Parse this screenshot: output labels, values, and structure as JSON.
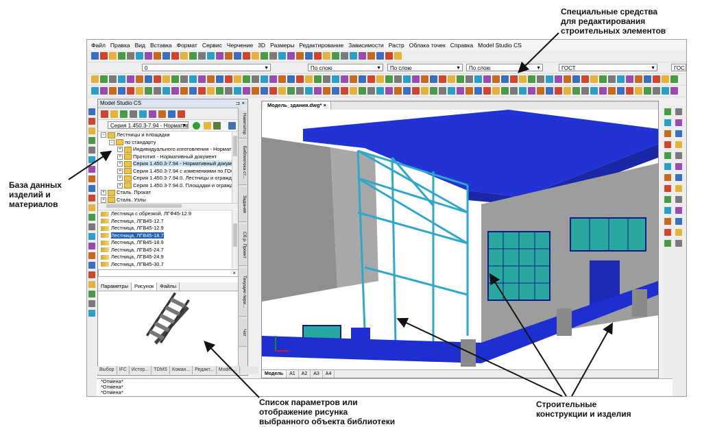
{
  "annotations": {
    "top_right": "Специальные средства\nдля редактирования\nстроительных элементов",
    "left": "База данных\nизделий и\nматериалов",
    "bottom_center": "Список параметров или\nотображение рисунка\nвыбранного объекта библиотеки",
    "bottom_right": "Строительные\nконструкции и изделия"
  },
  "menu": [
    "Файл",
    "Правка",
    "Вид",
    "Вставка",
    "Формат",
    "Сервис",
    "Черчение",
    "3D",
    "Размеры",
    "Редактирование",
    "Зависимости",
    "Растр",
    "Облака точек",
    "Справка",
    "Model Studio CS"
  ],
  "toolbar": {
    "layer_value": "0",
    "linetype_combo": "По слою",
    "lineweight_combo": "По слою",
    "color_combo": "По слою",
    "textstyle_combo": "ГОСТ",
    "dimstyle_combo": "ГОС"
  },
  "panel": {
    "title": "Model Studio CS",
    "pin": "⊐ ×",
    "series_combo": "Серия 1.450.3-7.94 - Норматив",
    "tree": [
      {
        "label": "Лестницы и площадки",
        "level": 0,
        "exp": "−",
        "sel": false
      },
      {
        "label": "по стандарту",
        "level": 1,
        "exp": "−",
        "sel": false
      },
      {
        "label": "Индивидуального изготовления - Норматив",
        "level": 2,
        "exp": "+",
        "sel": false
      },
      {
        "label": "Прототип - Нормативный документ",
        "level": 2,
        "exp": "+",
        "sel": false
      },
      {
        "label": "Серия 1.450.3-7.94 - Нормативный документ",
        "level": 2,
        "exp": "+",
        "sel": true
      },
      {
        "label": "Серия 1.450.3-7.94 с изменениями по ГОСТ",
        "level": 2,
        "exp": "+",
        "sel": false
      },
      {
        "label": "Серия 1.450.3-7.94.0. Лестницы и ограждения",
        "level": 2,
        "exp": "+",
        "sel": false
      },
      {
        "label": "Серия 1.450.3-7.94.0. Площадки и ограждения",
        "level": 2,
        "exp": "+",
        "sel": false
      },
      {
        "label": "Сталь. Прокат",
        "level": 0,
        "exp": "+",
        "sel": false
      },
      {
        "label": "Сталь. Узлы",
        "level": 0,
        "exp": "+",
        "sel": false
      }
    ],
    "list": [
      {
        "label": "Лестница с обрезкой, ЛГФ45-12.9",
        "sel": false
      },
      {
        "label": "Лестница, ЛГВ45-12.7",
        "sel": false
      },
      {
        "label": "Лестница, ЛГВ45-12.9",
        "sel": false
      },
      {
        "label": "Лестница, ЛГВ45-18.7",
        "sel": true
      },
      {
        "label": "Лестница, ЛГВ45-18.9",
        "sel": false
      },
      {
        "label": "Лестница, ЛГВ45-24.7",
        "sel": false
      },
      {
        "label": "Лестница, ЛГВ45-24.9",
        "sel": false
      },
      {
        "label": "Лестница, ЛГВ45-30.7",
        "sel": false
      }
    ],
    "filter_close": "×",
    "tabs": [
      "Параметры",
      "Рисунок",
      "Файлы"
    ],
    "active_tab": 1,
    "side_tabs": [
      "Навигатор",
      "Библиотека ст...",
      "Задания",
      "Сб.р. Проект",
      "Текущие пере...",
      "Чат"
    ]
  },
  "bottom_tabs": [
    "Выбор",
    "IFC",
    "Истор...",
    "TDMS",
    "Коман...",
    "Редакт...",
    "Model ..."
  ],
  "document": {
    "tab": "Модель_здания.dwg*",
    "tab_close": "×",
    "layout_tabs": [
      "Модель",
      "A1",
      "A2",
      "A3",
      "A4"
    ]
  },
  "command_lines": [
    "*Отмена*",
    "*Отмена*",
    "*Отмена*"
  ],
  "colors": {
    "accent": "#1f5fb8",
    "steel_cyan": "#2fa7c9",
    "glass": "#29a8a0",
    "roof_blue": "#1d2fd0",
    "wall_grey": "#9a9a9a"
  }
}
